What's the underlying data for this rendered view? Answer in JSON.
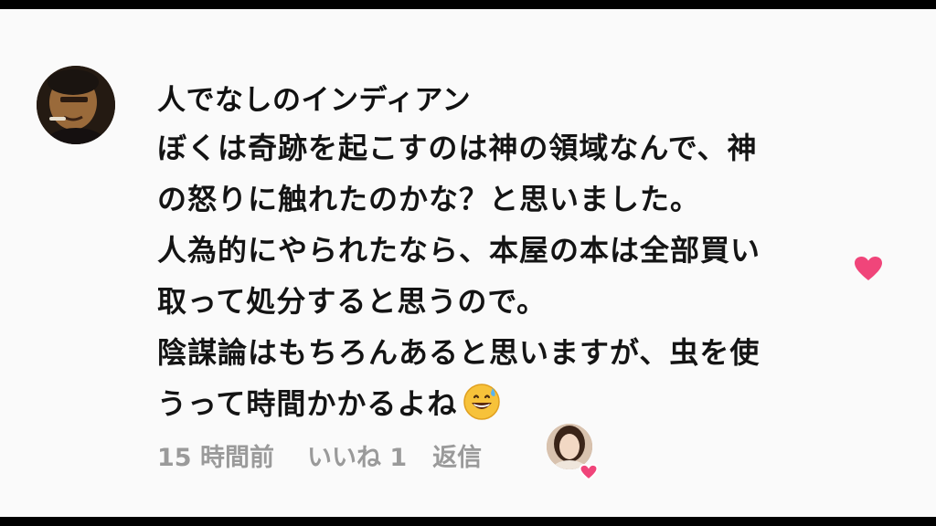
{
  "comment": {
    "username": "人でなしのインディアン",
    "lines": [
      "ぼくは奇跡を起こすのは神の領域なんで、神",
      "の怒りに触れたのかな？と思いました。",
      "人為的にやられたなら、本屋の本は全部買い",
      "取って処分すると思うので。",
      "陰謀論はもちろんあると思いますが、虫を使",
      "うって時間かかるよね"
    ],
    "emoji": "grinning-face-with-sweat-icon",
    "timestamp": "15 時間前",
    "likes_label": "いいね 1",
    "reply_label": "返信"
  },
  "colors": {
    "heart": "#f0457a",
    "meta_text": "#9a9a9a",
    "body_text": "#141414",
    "background": "#fafafa"
  }
}
